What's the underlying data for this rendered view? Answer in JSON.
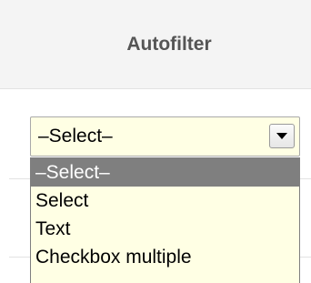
{
  "header": {
    "title": "Autofilter"
  },
  "select": {
    "value": "–Select–",
    "options": [
      {
        "label": "–Select–",
        "highlighted": true
      },
      {
        "label": "Select",
        "highlighted": false
      },
      {
        "label": "Text",
        "highlighted": false
      },
      {
        "label": "Checkbox multiple",
        "highlighted": false
      }
    ]
  },
  "colors": {
    "field_background": "#ffffe4",
    "highlight": "#7f7f7f",
    "header_background": "#f4f4f4",
    "header_text": "#555555"
  }
}
